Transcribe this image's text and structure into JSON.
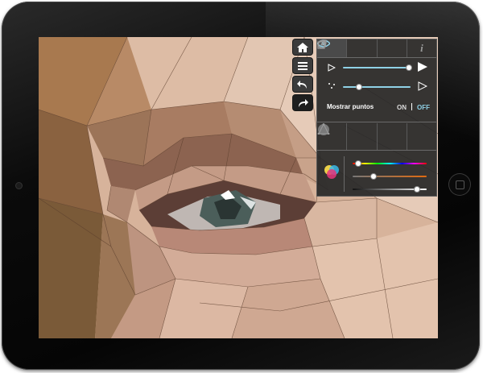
{
  "device": {
    "name": "tablet"
  },
  "toolbar": {
    "buttons": [
      {
        "icon": "home-icon"
      },
      {
        "icon": "layers-icon"
      },
      {
        "icon": "undo-icon"
      },
      {
        "icon": "redo-icon"
      }
    ]
  },
  "panel": {
    "tabs": [
      {
        "icon": "eye-icon",
        "active": true
      },
      {
        "icon": "settings-icon",
        "active": false
      },
      {
        "icon": "share-icon",
        "active": false
      },
      {
        "icon": "info-icon",
        "active": false,
        "text": "i"
      }
    ],
    "sliders": [
      {
        "icon": "triangle-outline-icon",
        "level": 0.95
      },
      {
        "icon": "points-icon",
        "level": 0.2
      }
    ],
    "show_points": {
      "label": "Mostrar puntos",
      "on": "ON",
      "off": "OFF",
      "state": "OFF"
    },
    "tools": [
      {
        "icon": "eyedropper-icon"
      },
      {
        "icon": "triangle-fill-icon"
      },
      {
        "icon": "blur-icon"
      },
      {
        "icon": "mesh-icon"
      }
    ],
    "color_sliders": [
      {
        "name": "hue",
        "level": 0.07
      },
      {
        "name": "saturation",
        "level": 0.27
      },
      {
        "name": "brightness",
        "level": 0.86
      }
    ],
    "colors": {
      "accent": "#8fd1e6",
      "panel_bg": "#2b2b2b"
    }
  }
}
